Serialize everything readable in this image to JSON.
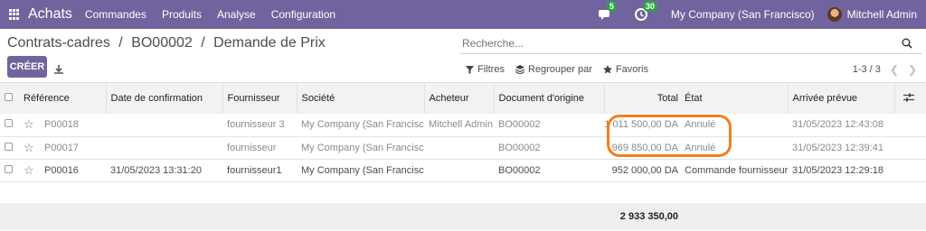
{
  "navbar": {
    "app_name": "Achats",
    "menu": [
      "Commandes",
      "Produits",
      "Analyse",
      "Configuration"
    ],
    "messages_count": "5",
    "activities_count": "30",
    "company": "My Company (San Francisco)",
    "user": "Mitchell Admin"
  },
  "breadcrumb": {
    "level1": "Contrats-cadres",
    "sep": "/",
    "level2": "BO00002",
    "level3": "Demande de Prix"
  },
  "search": {
    "placeholder": "Recherche..."
  },
  "actions": {
    "create_label": "CRÉER"
  },
  "filters": {
    "filters_label": "Filtres",
    "groupby_label": "Regrouper par",
    "favorites_label": "Favoris"
  },
  "pager": {
    "range": "1-3 / 3"
  },
  "table": {
    "columns": [
      "Référence",
      "Date de confirmation",
      "Fournisseur",
      "Société",
      "Acheteur",
      "Document d'origine",
      "Total",
      "État",
      "Arrivée prévue"
    ],
    "rows": [
      {
        "ref": "P00018",
        "date": "",
        "supplier": "fournisseur 3",
        "company": "My Company (San Francisco)",
        "buyer": "Mitchell Admin",
        "origin": "BO00002",
        "total": "1 011 500,00 DA",
        "state": "Annulé",
        "arrival": "31/05/2023 12:43:08"
      },
      {
        "ref": "P00017",
        "date": "",
        "supplier": "fournisseur",
        "company": "My Company (San Francisco)",
        "buyer": "",
        "origin": "BO00002",
        "total": "969 850,00 DA",
        "state": "Annulé",
        "arrival": "31/05/2023 12:39:41"
      },
      {
        "ref": "P00016",
        "date": "31/05/2023 13:31:20",
        "supplier": "fournisseur1",
        "company": "My Company (San Francisco)",
        "buyer": "",
        "origin": "BO00002",
        "total": "952 000,00 DA",
        "state": "Commande fournisseur",
        "arrival": "31/05/2023 12:29:18"
      }
    ],
    "grand_total": "2 933 350,00"
  },
  "colors": {
    "brand": "#71639e",
    "highlight": "#f47e20",
    "badge": "#28a745"
  }
}
